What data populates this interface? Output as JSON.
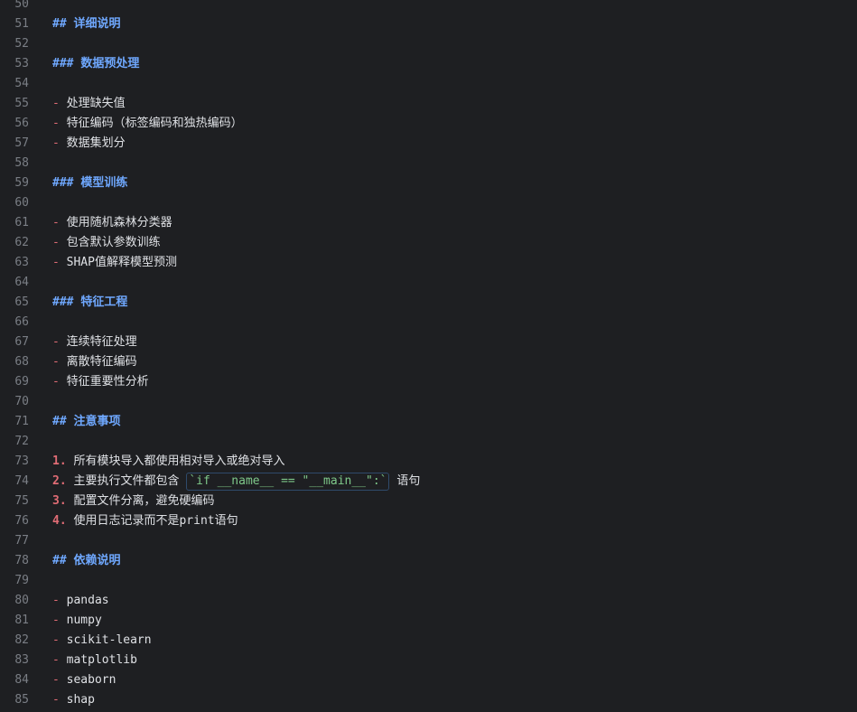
{
  "editor": {
    "lines": [
      {
        "n": "50",
        "kind": "empty"
      },
      {
        "n": "51",
        "kind": "header",
        "marker": "##",
        "text": "详细说明"
      },
      {
        "n": "52",
        "kind": "empty"
      },
      {
        "n": "53",
        "kind": "header",
        "marker": "###",
        "text": "数据预处理"
      },
      {
        "n": "54",
        "kind": "empty"
      },
      {
        "n": "55",
        "kind": "bullet",
        "marker": "-",
        "text": "处理缺失值"
      },
      {
        "n": "56",
        "kind": "bullet",
        "marker": "-",
        "text": "特征编码（标签编码和独热编码）"
      },
      {
        "n": "57",
        "kind": "bullet",
        "marker": "-",
        "text": "数据集划分"
      },
      {
        "n": "58",
        "kind": "empty"
      },
      {
        "n": "59",
        "kind": "header",
        "marker": "###",
        "text": "模型训练"
      },
      {
        "n": "60",
        "kind": "empty"
      },
      {
        "n": "61",
        "kind": "bullet",
        "marker": "-",
        "text": "使用随机森林分类器"
      },
      {
        "n": "62",
        "kind": "bullet",
        "marker": "-",
        "text": "包含默认参数训练"
      },
      {
        "n": "63",
        "kind": "bullet",
        "marker": "-",
        "text": "SHAP值解释模型预测"
      },
      {
        "n": "64",
        "kind": "empty"
      },
      {
        "n": "65",
        "kind": "header",
        "marker": "###",
        "text": "特征工程"
      },
      {
        "n": "66",
        "kind": "empty"
      },
      {
        "n": "67",
        "kind": "bullet",
        "marker": "-",
        "text": "连续特征处理"
      },
      {
        "n": "68",
        "kind": "bullet",
        "marker": "-",
        "text": "离散特征编码"
      },
      {
        "n": "69",
        "kind": "bullet",
        "marker": "-",
        "text": "特征重要性分析"
      },
      {
        "n": "70",
        "kind": "empty"
      },
      {
        "n": "71",
        "kind": "header",
        "marker": "##",
        "text": "注意事项"
      },
      {
        "n": "72",
        "kind": "empty"
      },
      {
        "n": "73",
        "kind": "numbered",
        "marker": "1.",
        "text": "所有模块导入都使用相对导入或绝对导入"
      },
      {
        "n": "74",
        "kind": "numbered",
        "marker": "2.",
        "text": "主要执行文件都包含",
        "code": "`if __name__ == \"__main__\":`",
        "after": "语句"
      },
      {
        "n": "75",
        "kind": "numbered",
        "marker": "3.",
        "text": "配置文件分离，避免硬编码"
      },
      {
        "n": "76",
        "kind": "numbered",
        "marker": "4.",
        "text": "使用日志记录而不是print语句"
      },
      {
        "n": "77",
        "kind": "empty"
      },
      {
        "n": "78",
        "kind": "header",
        "marker": "##",
        "text": "依赖说明"
      },
      {
        "n": "79",
        "kind": "empty"
      },
      {
        "n": "80",
        "kind": "bullet",
        "marker": "-",
        "text": "pandas"
      },
      {
        "n": "81",
        "kind": "bullet",
        "marker": "-",
        "text": "numpy"
      },
      {
        "n": "82",
        "kind": "bullet",
        "marker": "-",
        "text": "scikit-learn"
      },
      {
        "n": "83",
        "kind": "bullet",
        "marker": "-",
        "text": "matplotlib"
      },
      {
        "n": "84",
        "kind": "bullet",
        "marker": "-",
        "text": "seaborn"
      },
      {
        "n": "85",
        "kind": "bullet",
        "marker": "-",
        "text": "shap"
      }
    ]
  },
  "colors": {
    "background": "#1e1f22",
    "line_number": "#7a7e85",
    "header": "#6fa8ff",
    "bullet": "#e06c75",
    "text": "#dfe1e5",
    "code": "#7fc98a"
  }
}
